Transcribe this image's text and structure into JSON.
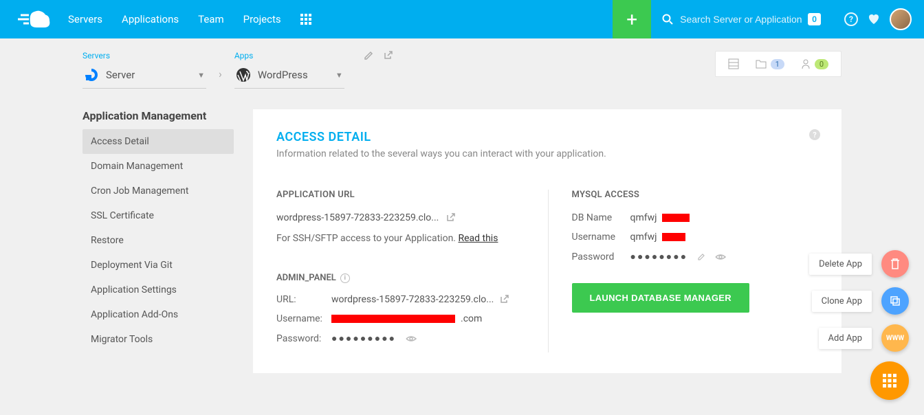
{
  "topbar": {
    "nav": [
      "Servers",
      "Applications",
      "Team",
      "Projects"
    ],
    "search_placeholder": "Search Server or Application",
    "badge": "0"
  },
  "breadcrumb": {
    "servers_label": "Servers",
    "server_name": "Server",
    "apps_label": "Apps",
    "app_name": "WordPress"
  },
  "stats": {
    "folder": "1",
    "user": "0"
  },
  "sidebar": {
    "title": "Application Management",
    "items": [
      "Access Detail",
      "Domain Management",
      "Cron Job Management",
      "SSL Certificate",
      "Restore",
      "Deployment Via Git",
      "Application Settings",
      "Application Add-Ons",
      "Migrator Tools"
    ]
  },
  "page": {
    "title": "ACCESS DETAIL",
    "subtitle": "Information related to the several ways you can interact with your application."
  },
  "app_url": {
    "title": "APPLICATION URL",
    "url": "wordpress-15897-72833-223259.clo...",
    "note_prefix": "For SSH/SFTP access to your Application. ",
    "note_link": "Read this"
  },
  "admin_panel": {
    "title": "ADMIN_PANEL",
    "url_label": "URL:",
    "url_value": "wordpress-15897-72833-223259.clo...",
    "username_label": "Username:",
    "username_suffix": ".com",
    "password_label": "Password:",
    "password_value": "●●●●●●●●●"
  },
  "mysql": {
    "title": "MYSQL ACCESS",
    "db_label": "DB Name",
    "db_prefix": "qmfwj",
    "user_label": "Username",
    "user_prefix": "qmfwj",
    "pass_label": "Password",
    "pass_value": "●●●●●●●●",
    "launch_btn": "LAUNCH DATABASE MANAGER"
  },
  "fabs": {
    "delete": "Delete App",
    "clone": "Clone App",
    "add": "Add App"
  }
}
